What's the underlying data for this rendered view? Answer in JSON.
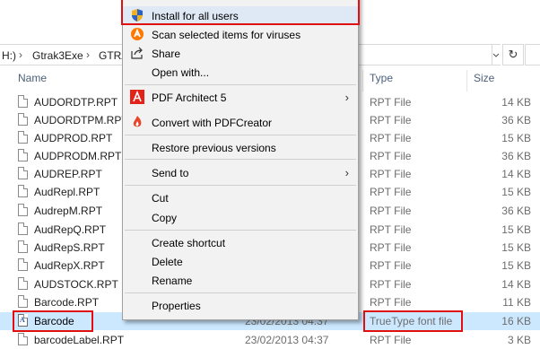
{
  "address_bar": {
    "crumbs": [
      "H:)",
      "Gtrak3Exe",
      "GTRA"
    ],
    "refresh_icon": "refresh-icon"
  },
  "columns": {
    "name": "Name",
    "type": "Type",
    "size": "Size"
  },
  "files": [
    {
      "name": "AUDORDTP.RPT",
      "date": "",
      "type": "RPT File",
      "size": "14 KB"
    },
    {
      "name": "AUDORDTPM.RPT",
      "date": "",
      "type": "RPT File",
      "size": "36 KB"
    },
    {
      "name": "AUDPROD.RPT",
      "date": "",
      "type": "RPT File",
      "size": "15 KB"
    },
    {
      "name": "AUDPRODM.RPT",
      "date": "",
      "type": "RPT File",
      "size": "36 KB"
    },
    {
      "name": "AUDREP.RPT",
      "date": "",
      "type": "RPT File",
      "size": "14 KB"
    },
    {
      "name": "AudRepl.RPT",
      "date": "",
      "type": "RPT File",
      "size": "15 KB"
    },
    {
      "name": "AudrepM.RPT",
      "date": "",
      "type": "RPT File",
      "size": "36 KB"
    },
    {
      "name": "AudRepQ.RPT",
      "date": "",
      "type": "RPT File",
      "size": "15 KB"
    },
    {
      "name": "AudRepS.RPT",
      "date": "",
      "type": "RPT File",
      "size": "15 KB"
    },
    {
      "name": "AudRepX.RPT",
      "date": "",
      "type": "RPT File",
      "size": "15 KB"
    },
    {
      "name": "AUDSTOCK.RPT",
      "date": "",
      "type": "RPT File",
      "size": "14 KB"
    },
    {
      "name": "Barcode.RPT",
      "date": "",
      "type": "RPT File",
      "size": "11 KB"
    },
    {
      "name": "Barcode",
      "date": "23/02/2013 04:37",
      "type": "TrueType font file",
      "size": "16 KB"
    },
    {
      "name": "barcodeLabel.RPT",
      "date": "23/02/2013 04:37",
      "type": "RPT File",
      "size": "3 KB"
    }
  ],
  "context_menu": {
    "items": [
      {
        "label": "Install for all users",
        "icon": "shield-icon"
      },
      {
        "label": "Scan selected items for viruses",
        "icon": "avast-icon"
      },
      {
        "label": "Share",
        "icon": "share-icon"
      },
      {
        "label": "Open with...",
        "icon": ""
      },
      {
        "label": "PDF Architect 5",
        "icon": "pdf-architect-icon"
      },
      {
        "label": "Convert with PDFCreator",
        "icon": "pdfcreator-icon"
      },
      {
        "label": "Restore previous versions",
        "icon": ""
      },
      {
        "label": "Send to",
        "icon": ""
      },
      {
        "label": "Cut",
        "icon": ""
      },
      {
        "label": "Copy",
        "icon": ""
      },
      {
        "label": "Create shortcut",
        "icon": ""
      },
      {
        "label": "Delete",
        "icon": ""
      },
      {
        "label": "Rename",
        "icon": ""
      },
      {
        "label": "Properties",
        "icon": ""
      }
    ]
  },
  "colors": {
    "selection": "#cce8ff",
    "highlight_outline": "#e01010"
  }
}
